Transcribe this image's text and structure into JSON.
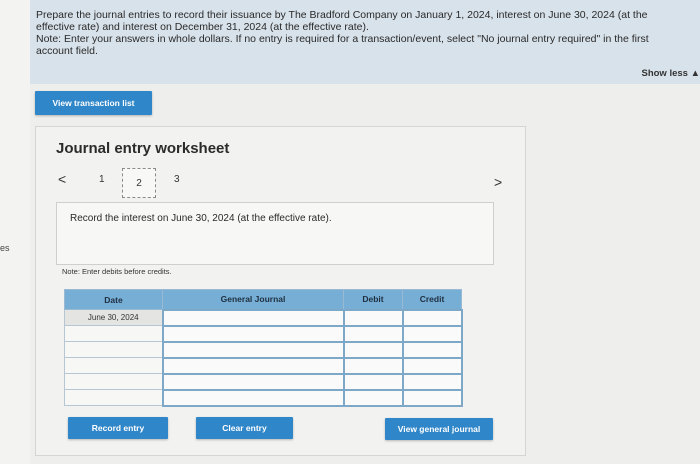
{
  "left_gutter": {
    "text": "es"
  },
  "instructions": {
    "line1": "Prepare the journal entries to record their issuance by The Bradford Company on January 1, 2024, interest on June 30, 2024 (at the",
    "line2": "effective rate) and interest on December 31, 2024 (at the effective rate).",
    "line3": "Note: Enter your answers in whole dollars. If no entry is required for a transaction/event, select \"No journal entry required\" in the first",
    "line4": "account field.",
    "show_less": "Show less ▲"
  },
  "buttons": {
    "view_transaction_list": "View transaction list",
    "record_entry": "Record entry",
    "clear_entry": "Clear entry",
    "view_general_journal": "View general journal"
  },
  "worksheet": {
    "title": "Journal entry worksheet",
    "nav_prev": "<",
    "nav_next": ">",
    "pages": [
      "1",
      "2",
      "3"
    ],
    "active_page": "2",
    "description": "Record the interest on June 30, 2024 (at the effective rate).",
    "note": "Note: Enter debits before credits."
  },
  "table": {
    "headers": {
      "date": "Date",
      "account": "General Journal",
      "debit": "Debit",
      "credit": "Credit"
    },
    "rows": [
      {
        "date": "June 30, 2024",
        "account": "",
        "debit": "",
        "credit": ""
      },
      {
        "date": "",
        "account": "",
        "debit": "",
        "credit": ""
      },
      {
        "date": "",
        "account": "",
        "debit": "",
        "credit": ""
      },
      {
        "date": "",
        "account": "",
        "debit": "",
        "credit": ""
      },
      {
        "date": "",
        "account": "",
        "debit": "",
        "credit": ""
      },
      {
        "date": "",
        "account": "",
        "debit": "",
        "credit": ""
      }
    ]
  }
}
